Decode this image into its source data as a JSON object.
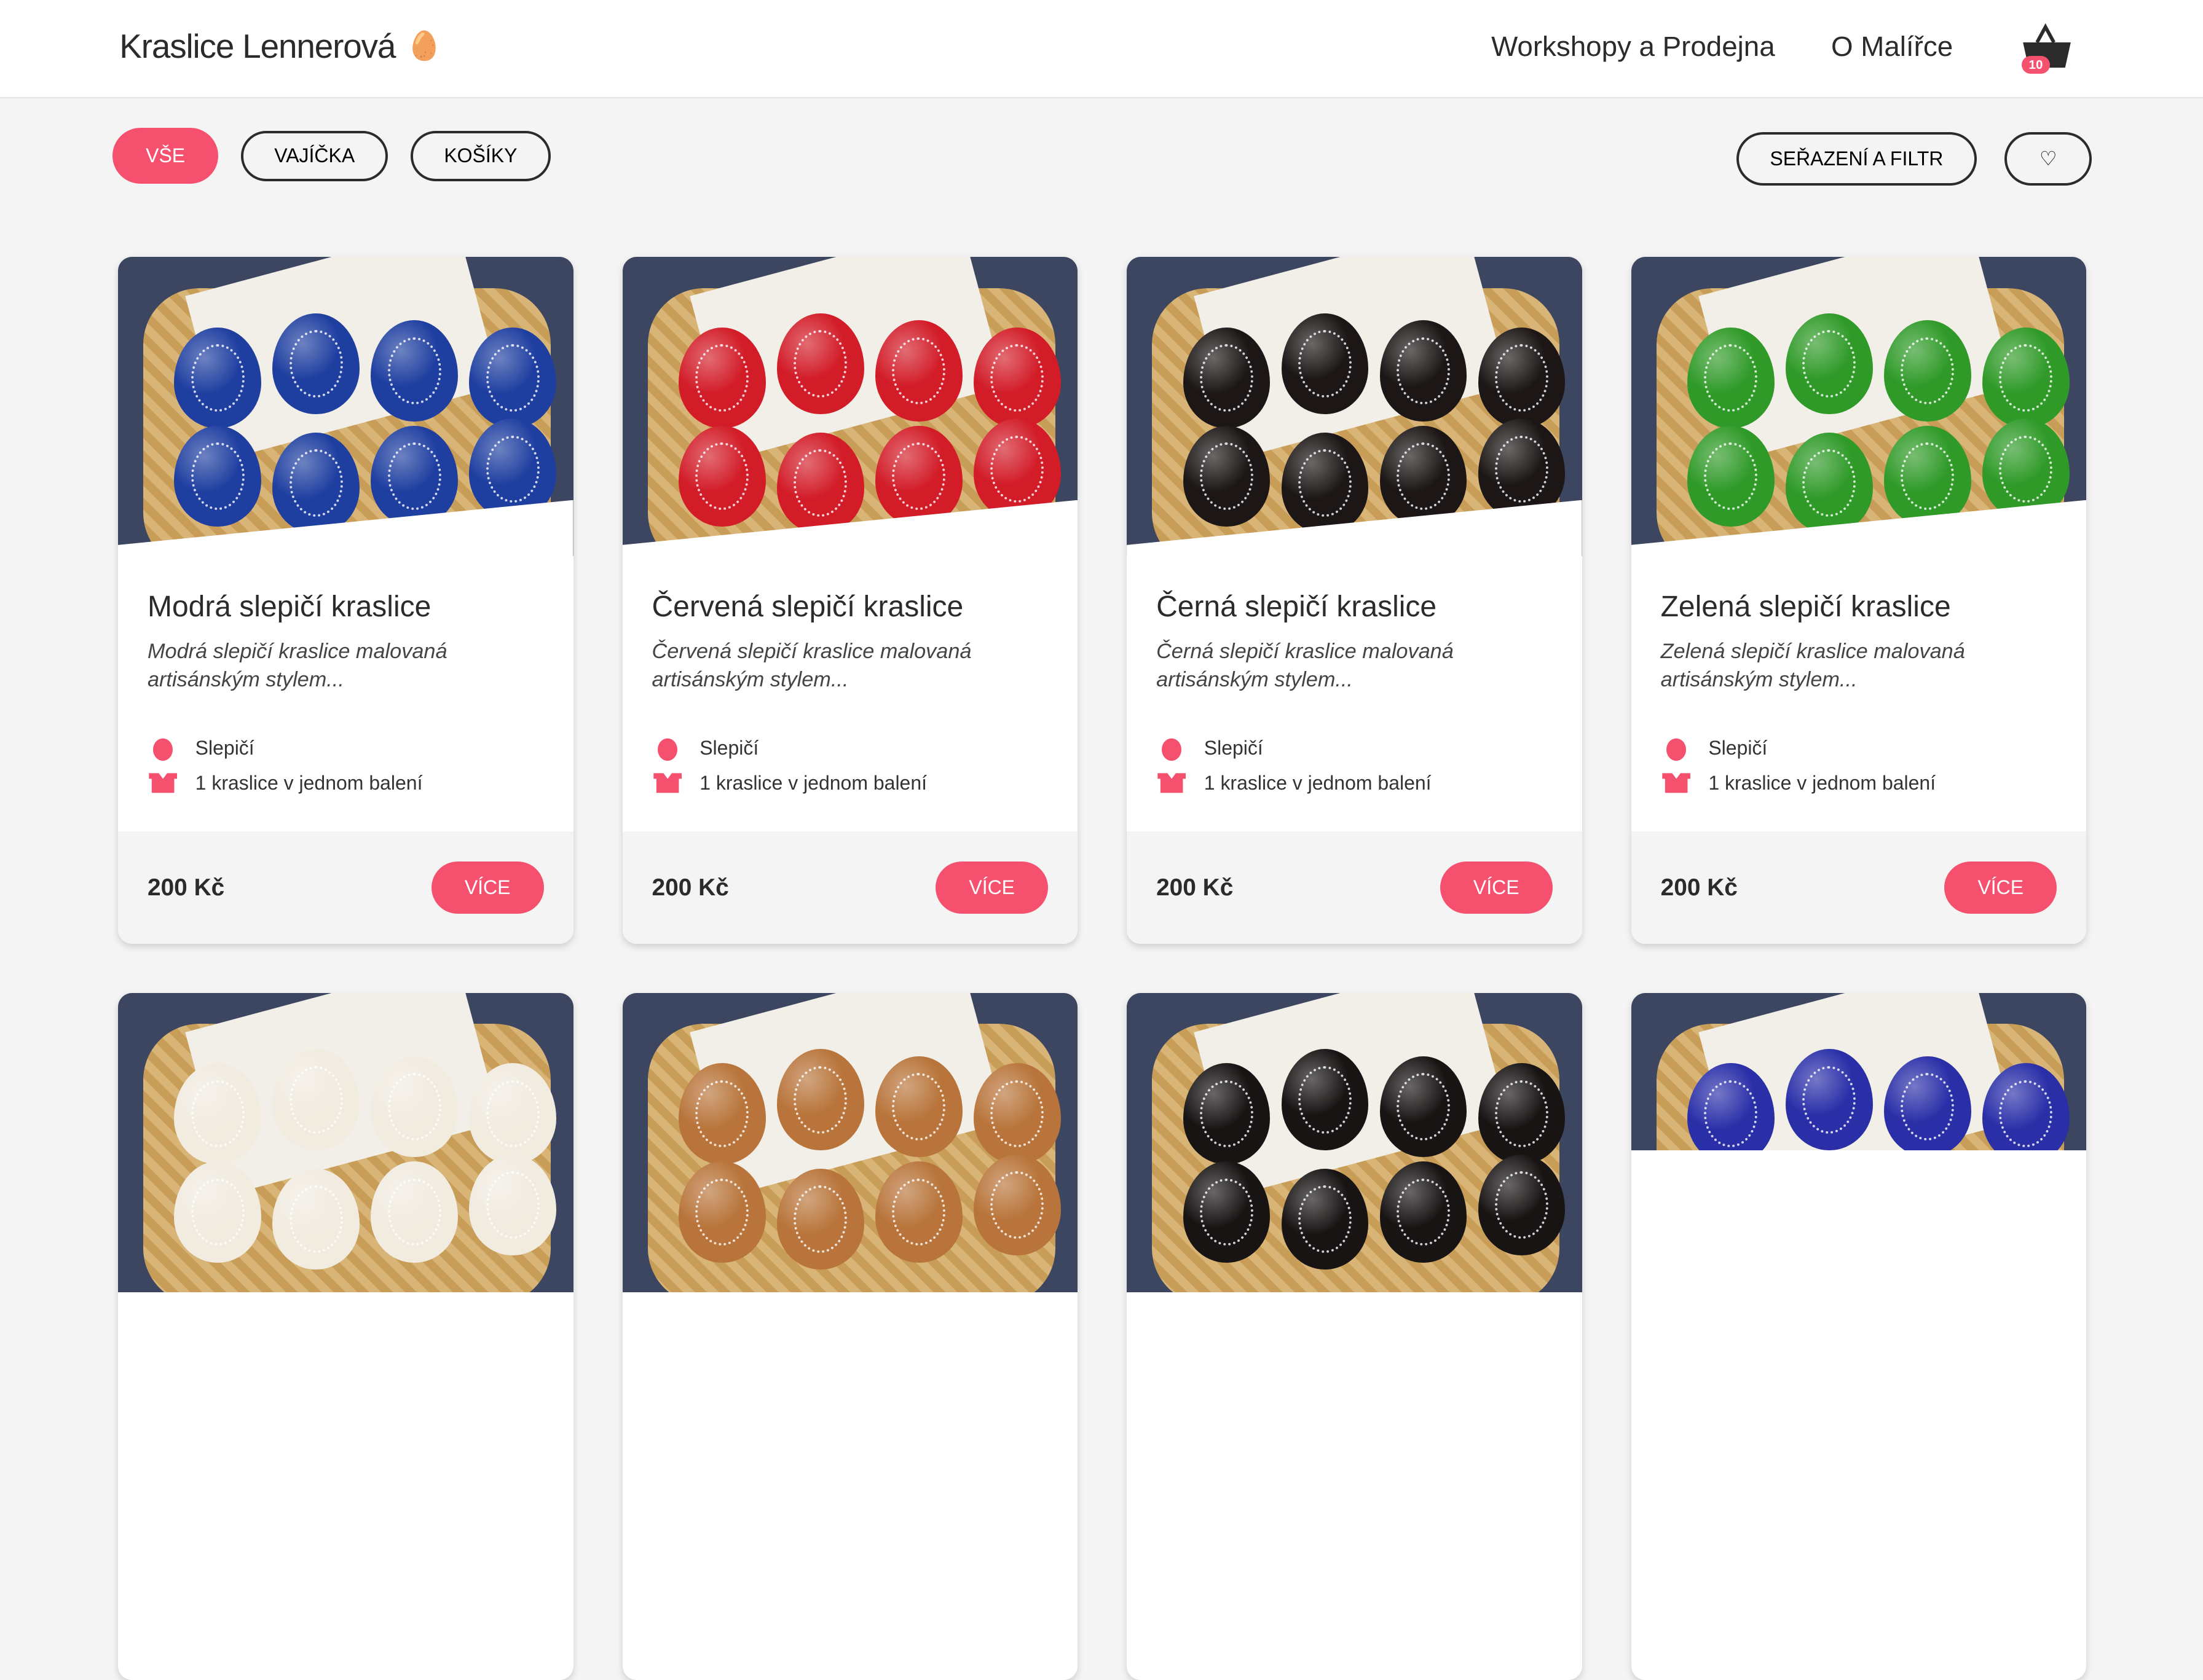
{
  "header": {
    "logo": "Kraslice  Lennerová",
    "nav": [
      {
        "label": "Workshopy  a  Prodejna"
      },
      {
        "label": "O  Malířce"
      }
    ],
    "cart_count": "10"
  },
  "filters": {
    "tabs": [
      {
        "label": "VŠE",
        "active": true
      },
      {
        "label": "VAJÍČKA"
      },
      {
        "label": "KOŠÍKY"
      }
    ],
    "sort_label": "SEŘAZENÍ A FILTR",
    "favorites_icon": "heart-icon"
  },
  "colors": {
    "accent": "#f5516f"
  },
  "products": [
    {
      "title": "Modrá slepičí kraslice",
      "desc": "Modrá slepičí kraslice malovaná artisánským stylem...",
      "type": "Slepičí",
      "pack": "1 kraslice v jednom balení",
      "price": "200 Kč",
      "button": "VÍCE",
      "egg_color": "#1f3fa0"
    },
    {
      "title": "Červená slepičí kraslice",
      "desc": "Červená slepičí kraslice malovaná artisánským stylem...",
      "type": "Slepičí",
      "pack": "1 kraslice v jednom balení",
      "price": "200 Kč",
      "button": "VÍCE",
      "egg_color": "#d21c28"
    },
    {
      "title": "Černá slepičí kraslice",
      "desc": "Černá slepičí kraslice malovaná artisánským stylem...",
      "type": "Slepičí",
      "pack": "1 kraslice v jednom balení",
      "price": "200 Kč",
      "button": "VÍCE",
      "egg_color": "#1c1616"
    },
    {
      "title": "Zelená slepičí kraslice",
      "desc": "Zelená slepičí kraslice malovaná artisánským stylem...",
      "type": "Slepičí",
      "pack": "1 kraslice v jednom balení",
      "price": "200 Kč",
      "button": "VÍCE",
      "egg_color": "#2f9a28"
    },
    {
      "egg_color": "#f1ebe0"
    },
    {
      "egg_color": "#b8743a"
    },
    {
      "egg_color": "#181414"
    },
    {
      "egg_color": "#2a2fa8"
    }
  ]
}
